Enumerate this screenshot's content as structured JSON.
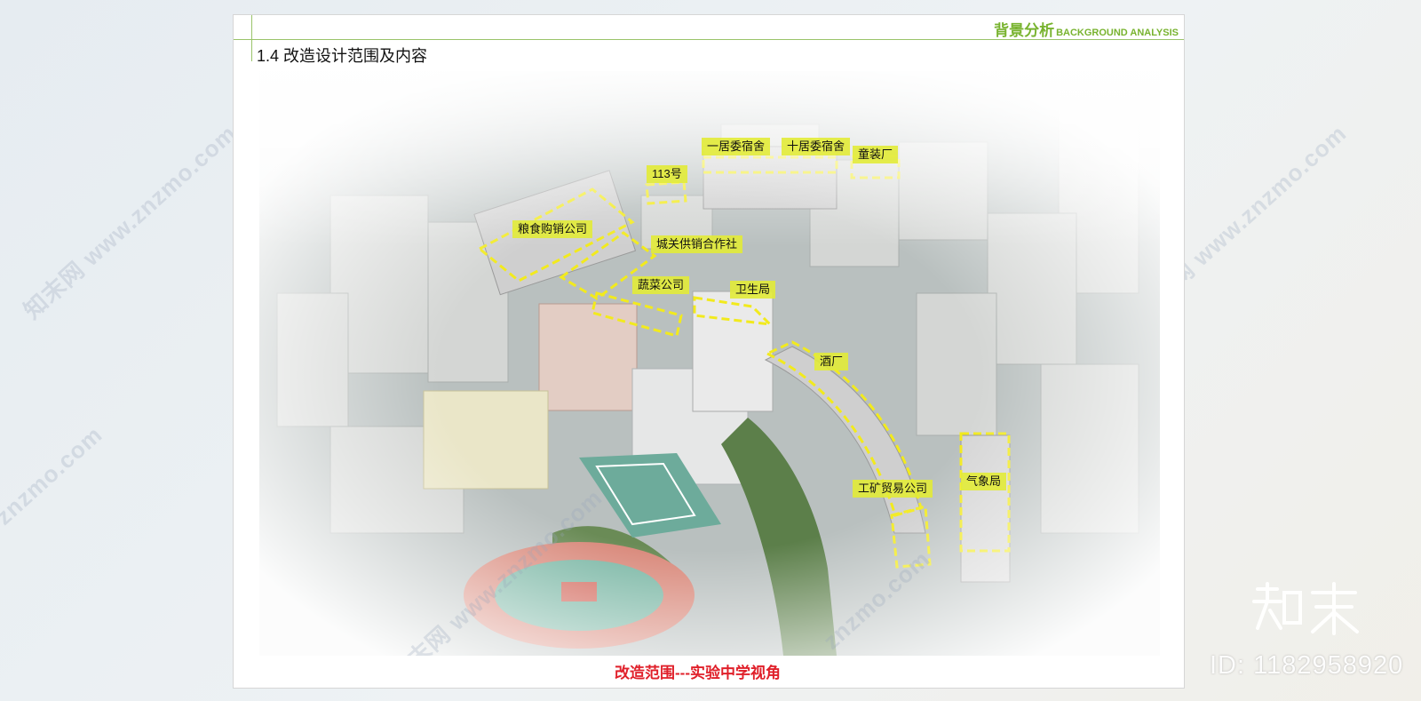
{
  "header": {
    "title_cn": "背景分析",
    "title_en": "BACKGROUND ANALYSIS",
    "section": "1.4 改造设计范围及内容"
  },
  "photo": {
    "labels": [
      "一居委宿舍",
      "十居委宿舍",
      "童装厂",
      "113号",
      "粮食购销公司",
      "城关供销合作社",
      "蔬菜公司",
      "卫生局",
      "酒厂",
      "工矿贸易公司",
      "气象局"
    ]
  },
  "caption": "改造范围---实验中学视角",
  "watermarks": {
    "site": "知末网 www.znzmo.com",
    "short": "znzmo.com",
    "brand": "知末",
    "id": "ID: 1182958920"
  },
  "colors": {
    "accent": "#78b32f",
    "caption": "#e0202a",
    "highlight": "#e2eb37"
  }
}
